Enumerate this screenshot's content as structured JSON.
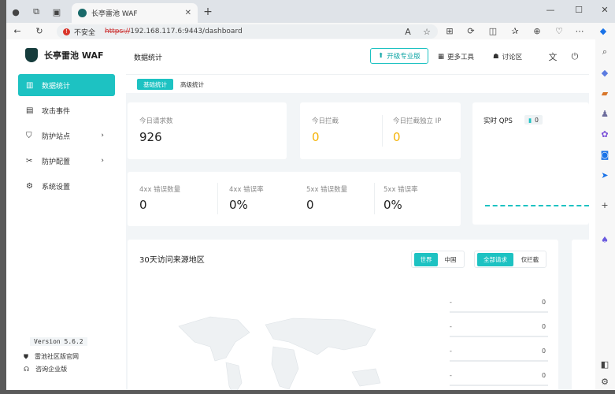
{
  "browser": {
    "tab_title": "长亭雷池 WAF",
    "insecure_label": "不安全",
    "url_scheme": "https://",
    "url_rest": "192.168.117.6:9443/dashboard"
  },
  "sidebar": {
    "brand": "长亭雷池 WAF",
    "items": [
      {
        "label": "数据统计",
        "icon": "bar-chart-icon",
        "active": true
      },
      {
        "label": "攻击事件",
        "icon": "event-icon"
      },
      {
        "label": "防护站点",
        "icon": "shield-icon",
        "chevron": true
      },
      {
        "label": "防护配置",
        "icon": "tools-icon",
        "chevron": true
      },
      {
        "label": "系统设置",
        "icon": "gear-icon"
      }
    ],
    "version": "Version 5.6.2",
    "footer_links": [
      "雷池社区版官网",
      "咨询企业版"
    ]
  },
  "header": {
    "title": "数据统计",
    "upgrade": "开级专业版",
    "more_tools": "更多工具",
    "discuss": "讨论区"
  },
  "subtabs": [
    "基础统计",
    "高级统计"
  ],
  "stats": {
    "today_requests_label": "今日请求数",
    "today_requests": "926",
    "today_blocked_label": "今日拦截",
    "today_blocked": "0",
    "today_blocked_ip_label": "今日拦截独立 IP",
    "today_blocked_ip": "0",
    "qps_label": "实时 QPS",
    "qps_value": "0",
    "err_4xx_count_label": "4xx 错误数量",
    "err_4xx_count": "0",
    "err_4xx_rate_label": "4xx 错误率",
    "err_4xx_rate": "0%",
    "err_5xx_count_label": "5xx 错误数量",
    "err_5xx_count": "0",
    "err_5xx_rate_label": "5xx 错误率",
    "err_5xx_rate": "0%"
  },
  "region": {
    "title": "30天访问来源地区",
    "scope": [
      "世界",
      "中国"
    ],
    "filter": [
      "全部请求",
      "仅拦截"
    ],
    "rows": [
      {
        "name": "-",
        "value": "0"
      },
      {
        "name": "-",
        "value": "0"
      },
      {
        "name": "-",
        "value": "0"
      },
      {
        "name": "-",
        "value": "0"
      }
    ]
  },
  "colors": {
    "accent": "#1dc2c2",
    "warning": "#f5b40a"
  }
}
